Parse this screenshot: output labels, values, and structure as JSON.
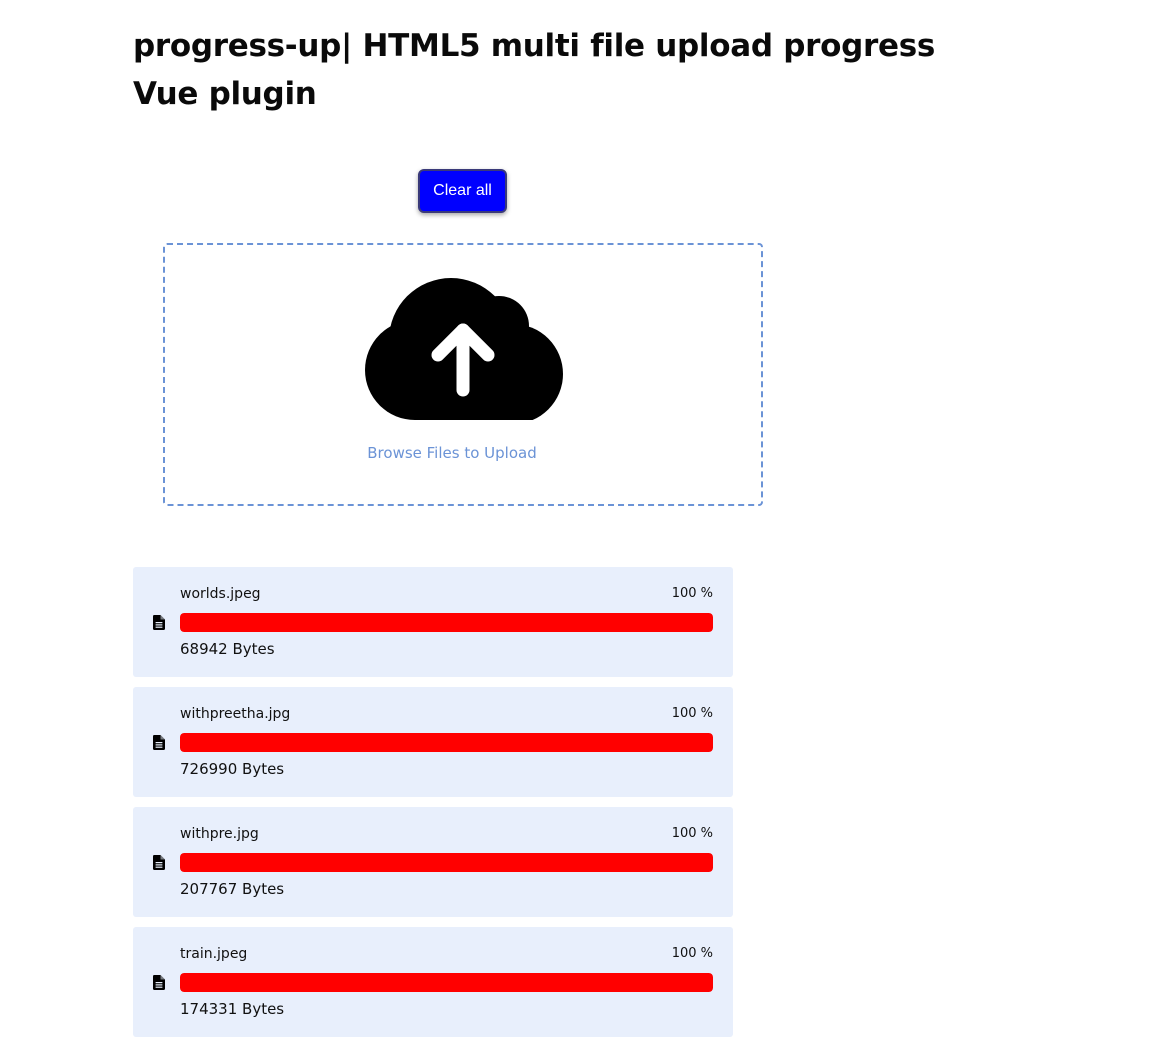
{
  "page": {
    "title": "progress-up| HTML5 multi file upload progress Vue plugin"
  },
  "toolbar": {
    "clear_label": "Clear all"
  },
  "dropzone": {
    "label": "Browse Files to Upload",
    "icon": "cloud-upload-icon",
    "border_color": "#6b93d6"
  },
  "colors": {
    "progress_fill": "#ff0000",
    "item_background": "#e8effc",
    "button_background": "#0000ff"
  },
  "files": [
    {
      "name": "worlds.jpeg",
      "percent_label": "100 %",
      "progress": 1.0,
      "size_label": "68942 Bytes",
      "icon": "file-icon"
    },
    {
      "name": "withpreetha.jpg",
      "percent_label": "100 %",
      "progress": 1.0,
      "size_label": "726990 Bytes",
      "icon": "file-icon"
    },
    {
      "name": "withpre.jpg",
      "percent_label": "100 %",
      "progress": 1.0,
      "size_label": "207767 Bytes",
      "icon": "file-icon"
    },
    {
      "name": "train.jpeg",
      "percent_label": "100 %",
      "progress": 1.0,
      "size_label": "174331 Bytes",
      "icon": "file-icon"
    }
  ]
}
